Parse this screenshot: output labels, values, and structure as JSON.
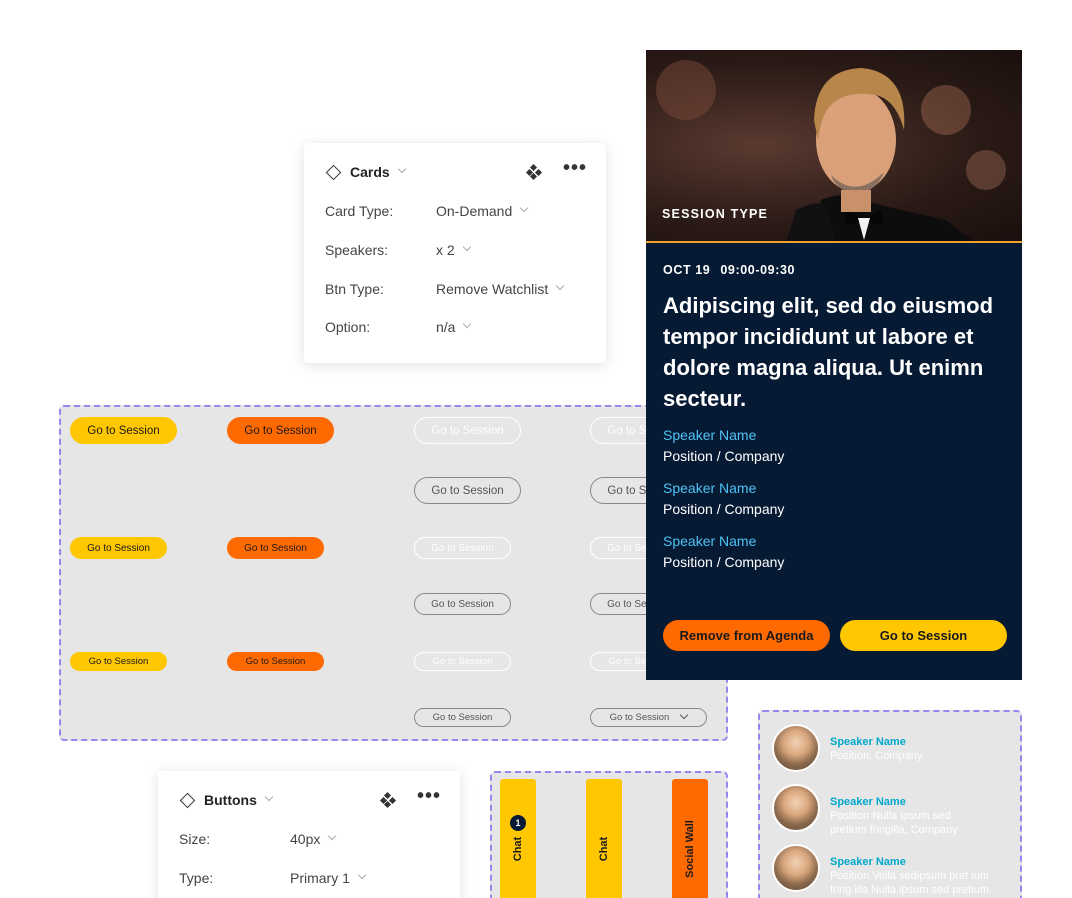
{
  "cards_panel": {
    "title": "Cards",
    "rows": [
      {
        "label": "Card Type:",
        "value": "On-Demand"
      },
      {
        "label": "Speakers:",
        "value": "x 2"
      },
      {
        "label": "Btn Type:",
        "value": "Remove Watchlist"
      },
      {
        "label": "Option:",
        "value": "n/a"
      }
    ]
  },
  "buttons_panel": {
    "title": "Buttons",
    "rows": [
      {
        "label": "Size:",
        "value": "40px"
      },
      {
        "label": "Type:",
        "value": "Primary 1"
      }
    ]
  },
  "button_grid": {
    "label": "Go to Session"
  },
  "session_card": {
    "session_type": "SESSION TYPE",
    "date": "OCT 19",
    "time": "09:00-09:30",
    "headline": "Adipiscing elit, sed do eiusmod tempor incididunt ut labore et dolore magna aliqua. Ut enimn secteur.",
    "speakers": [
      {
        "name": "Speaker Name",
        "position": "Position / Company"
      },
      {
        "name": "Speaker Name",
        "position": "Position / Company"
      },
      {
        "name": "Speaker Name",
        "position": "Position / Company"
      }
    ],
    "remove_label": "Remove from Agenda",
    "go_label": "Go to Session"
  },
  "speaker_list": [
    {
      "name": "Speaker Name",
      "position": "Position, Company"
    },
    {
      "name": "Speaker Name",
      "position": "Position Nulla ipsum sed pretium fringilla, Company"
    },
    {
      "name": "Speaker Name",
      "position": "Position Vella sedipsum pret ium fring illa Nulla ipsum sed pretium"
    }
  ],
  "tabs": {
    "chat_badge": "1",
    "chat1": "Chat",
    "chat2": "Chat",
    "social_wall": "Social Wall"
  },
  "colors": {
    "primary_yellow": "#ffc700",
    "primary_orange": "#ff6a00",
    "card_navy": "#061a33",
    "speaker_cyan": "#4fc3f7",
    "frame_purple": "#9a84f0"
  }
}
